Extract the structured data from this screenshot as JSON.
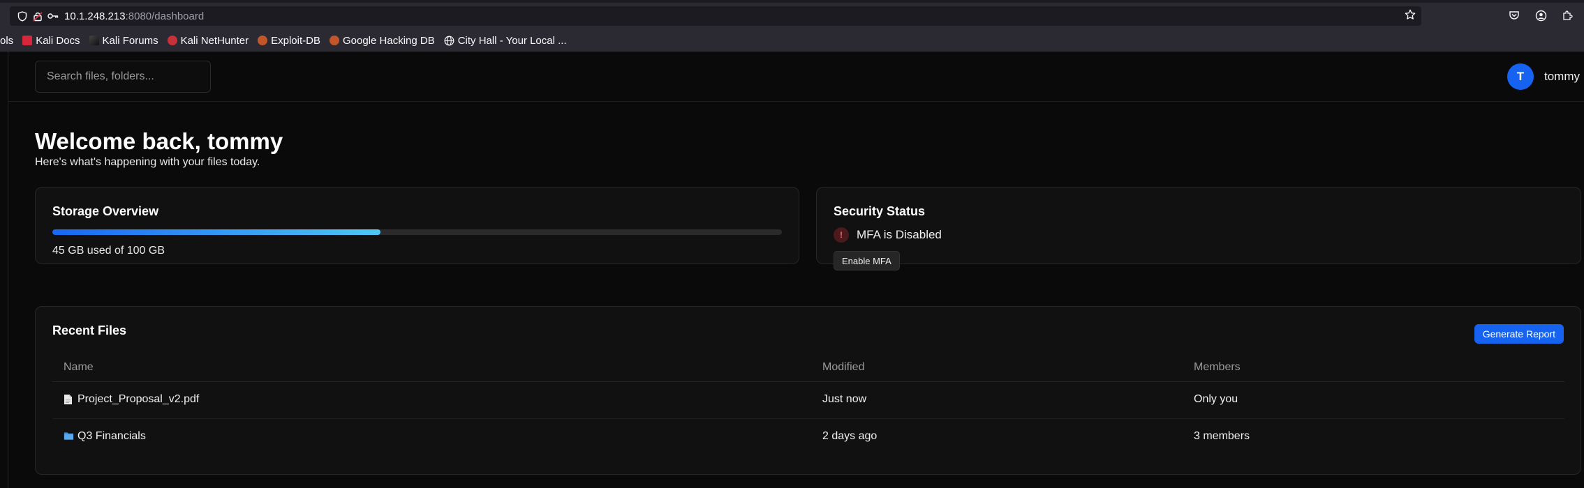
{
  "browser": {
    "url_host": "10.1.248.213",
    "url_path": ":8080/dashboard",
    "bookmarks": [
      {
        "label": "ols",
        "icon": "tools-icon"
      },
      {
        "label": "Kali Docs",
        "icon": "kali-docs-icon"
      },
      {
        "label": "Kali Forums",
        "icon": "kali-forums-icon"
      },
      {
        "label": "Kali NetHunter",
        "icon": "nethunter-icon"
      },
      {
        "label": "Exploit-DB",
        "icon": "exploit-db-icon"
      },
      {
        "label": "Google Hacking DB",
        "icon": "ghdb-icon"
      },
      {
        "label": "City Hall - Your Local ...",
        "icon": "globe-icon"
      }
    ]
  },
  "header": {
    "search_placeholder": "Search files, folders...",
    "user": {
      "initial": "T",
      "name": "tommy"
    }
  },
  "welcome": {
    "title": "Welcome back, tommy",
    "subtitle": "Here's what's happening with your files today."
  },
  "storage": {
    "title": "Storage Overview",
    "used_fraction": 0.45,
    "usage_text": "45 GB used of 100 GB"
  },
  "security": {
    "title": "Security Status",
    "status_text": "MFA is Disabled",
    "warning_glyph": "!",
    "enable_label": "Enable MFA"
  },
  "recent": {
    "title": "Recent Files",
    "report_label": "Generate Report",
    "columns": [
      "Name",
      "Modified",
      "Members"
    ],
    "rows": [
      {
        "name": "Project_Proposal_v2.pdf",
        "icon": "document-icon",
        "modified": "Just now",
        "members": "Only you"
      },
      {
        "name": "Q3 Financials",
        "icon": "folder-icon",
        "modified": "2 days ago",
        "members": "3 members"
      }
    ]
  },
  "colors": {
    "accent": "#1663f2",
    "bar_gradient_end": "#4fc7f5",
    "warning": "#f36b6b"
  }
}
